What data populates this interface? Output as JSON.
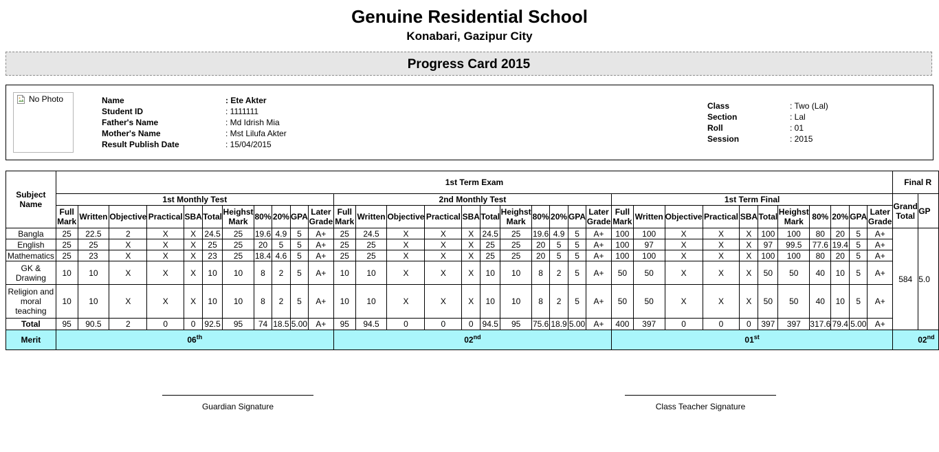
{
  "school": {
    "name": "Genuine Residential School",
    "address": "Konabari, Gazipur City"
  },
  "card_title": "Progress Card 2015",
  "photo": {
    "alt": "No Photo",
    "icon": "broken-image-icon"
  },
  "student": {
    "name_label": "Name",
    "name": "Ete Akter",
    "id_label": "Student ID",
    "id": "1111111",
    "father_label": "Father's Name",
    "father": "Md Idrish Mia",
    "mother_label": "Mother's Name",
    "mother": "Mst Lilufa Akter",
    "publish_label": "Result Publish Date",
    "publish_date": "15/04/2015",
    "class_label": "Class",
    "class": "Two (Lal)",
    "section_label": "Section",
    "section": "Lal",
    "roll_label": "Roll",
    "roll": "01",
    "session_label": "Session",
    "session": "2015"
  },
  "table": {
    "subject_header": "Subject Name",
    "term_header": "1st Term Exam",
    "final_header": "Final R",
    "test_names": [
      "1st Monthly Test",
      "2nd Monthly Test",
      "1st Term Final"
    ],
    "col_headers": [
      "Full Mark",
      "Written",
      "Objective",
      "Practical",
      "SBA",
      "Total",
      "Heighst Mark",
      "80%",
      "20%",
      "GPA",
      "Later Grade"
    ],
    "grand_total_header": "Grand Total",
    "gp_header": "GP",
    "subjects": [
      {
        "name": "Bangla",
        "tests": [
          [
            "25",
            "22.5",
            "2",
            "X",
            "X",
            "24.5",
            "25",
            "19.6",
            "4.9",
            "5",
            "A+"
          ],
          [
            "25",
            "24.5",
            "X",
            "X",
            "X",
            "24.5",
            "25",
            "19.6",
            "4.9",
            "5",
            "A+"
          ],
          [
            "100",
            "100",
            "X",
            "X",
            "X",
            "100",
            "100",
            "80",
            "20",
            "5",
            "A+"
          ]
        ]
      },
      {
        "name": "English",
        "tests": [
          [
            "25",
            "25",
            "X",
            "X",
            "X",
            "25",
            "25",
            "20",
            "5",
            "5",
            "A+"
          ],
          [
            "25",
            "25",
            "X",
            "X",
            "X",
            "25",
            "25",
            "20",
            "5",
            "5",
            "A+"
          ],
          [
            "100",
            "97",
            "X",
            "X",
            "X",
            "97",
            "99.5",
            "77.6",
            "19.4",
            "5",
            "A+"
          ]
        ]
      },
      {
        "name": "Mathematics",
        "tests": [
          [
            "25",
            "23",
            "X",
            "X",
            "X",
            "23",
            "25",
            "18.4",
            "4.6",
            "5",
            "A+"
          ],
          [
            "25",
            "25",
            "X",
            "X",
            "X",
            "25",
            "25",
            "20",
            "5",
            "5",
            "A+"
          ],
          [
            "100",
            "100",
            "X",
            "X",
            "X",
            "100",
            "100",
            "80",
            "20",
            "5",
            "A+"
          ]
        ]
      },
      {
        "name": "GK & Drawing",
        "tests": [
          [
            "10",
            "10",
            "X",
            "X",
            "X",
            "10",
            "10",
            "8",
            "2",
            "5",
            "A+"
          ],
          [
            "10",
            "10",
            "X",
            "X",
            "X",
            "10",
            "10",
            "8",
            "2",
            "5",
            "A+"
          ],
          [
            "50",
            "50",
            "X",
            "X",
            "X",
            "50",
            "50",
            "40",
            "10",
            "5",
            "A+"
          ]
        ]
      },
      {
        "name": "Religion and moral teaching",
        "tests": [
          [
            "10",
            "10",
            "X",
            "X",
            "X",
            "10",
            "10",
            "8",
            "2",
            "5",
            "A+"
          ],
          [
            "10",
            "10",
            "X",
            "X",
            "X",
            "10",
            "10",
            "8",
            "2",
            "5",
            "A+"
          ],
          [
            "50",
            "50",
            "X",
            "X",
            "X",
            "50",
            "50",
            "40",
            "10",
            "5",
            "A+"
          ]
        ]
      }
    ],
    "grand_total": "584",
    "gp_value": "5.0",
    "total_label": "Total",
    "total_row": [
      [
        "95",
        "90.5",
        "2",
        "0",
        "0",
        "92.5",
        "95",
        "74",
        "18.5",
        "5.00",
        "A+"
      ],
      [
        "95",
        "94.5",
        "0",
        "0",
        "0",
        "94.5",
        "95",
        "75.6",
        "18.9",
        "5.00",
        "A+"
      ],
      [
        "400",
        "397",
        "0",
        "0",
        "0",
        "397",
        "397",
        "317.6",
        "79.4",
        "5.00",
        "A+"
      ]
    ],
    "merit_label": "Merit",
    "merits": [
      {
        "num": "06",
        "suffix": "th"
      },
      {
        "num": "02",
        "suffix": "nd"
      },
      {
        "num": "01",
        "suffix": "st"
      }
    ],
    "final_merit": {
      "num": "02",
      "suffix": "nd"
    }
  },
  "signatures": {
    "guardian": "Guardian Signature",
    "teacher": "Class Teacher Signature"
  }
}
